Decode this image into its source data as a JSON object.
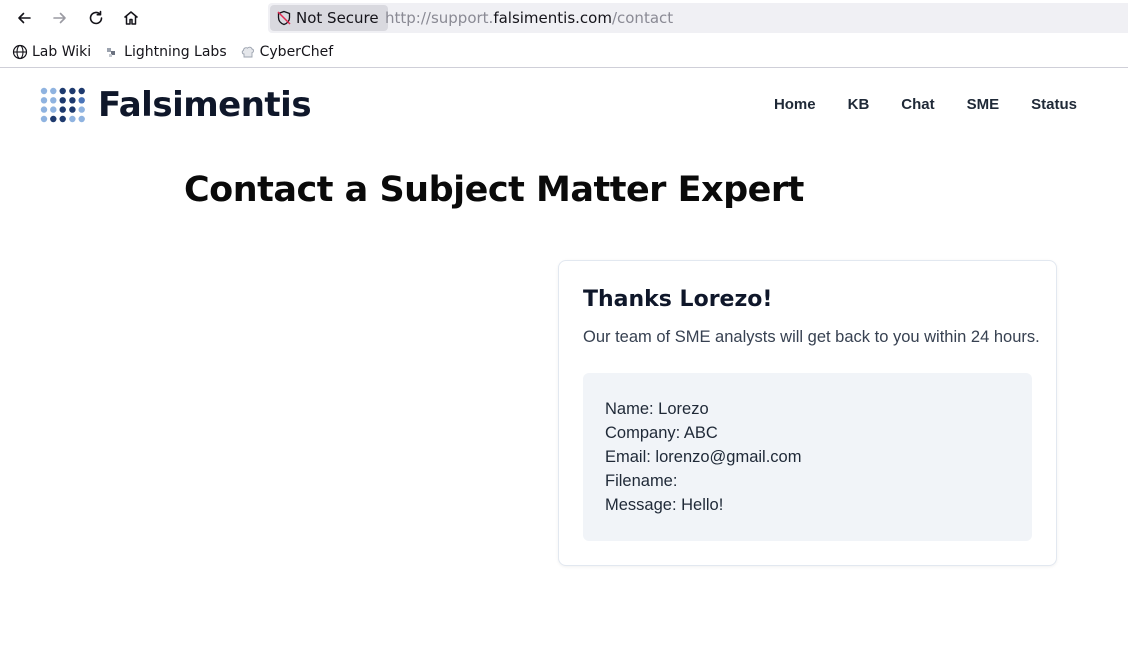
{
  "browser": {
    "security_label": "Not Secure",
    "url": {
      "prefix": "http://support.",
      "host": "falsimentis.com",
      "path": "/contact"
    },
    "bookmarks": [
      {
        "label": "Lab Wiki",
        "icon": "globe-icon"
      },
      {
        "label": "Lightning Labs",
        "icon": "lightning-labs-icon"
      },
      {
        "label": "CyberChef",
        "icon": "chef-hat-icon"
      }
    ]
  },
  "site": {
    "brand": "Falsimentis",
    "nav": [
      "Home",
      "KB",
      "Chat",
      "SME",
      "Status"
    ]
  },
  "page": {
    "title": "Contact a Subject Matter Expert"
  },
  "confirmation": {
    "title": "Thanks Lorezo!",
    "subtitle": "Our team of SME analysts will get back to you within 24 hours.",
    "details": [
      "Name: Lorezo",
      "Company: ABC",
      "Email: lorenzo@gmail.com",
      "Filename:",
      "Message: Hello!"
    ]
  }
}
